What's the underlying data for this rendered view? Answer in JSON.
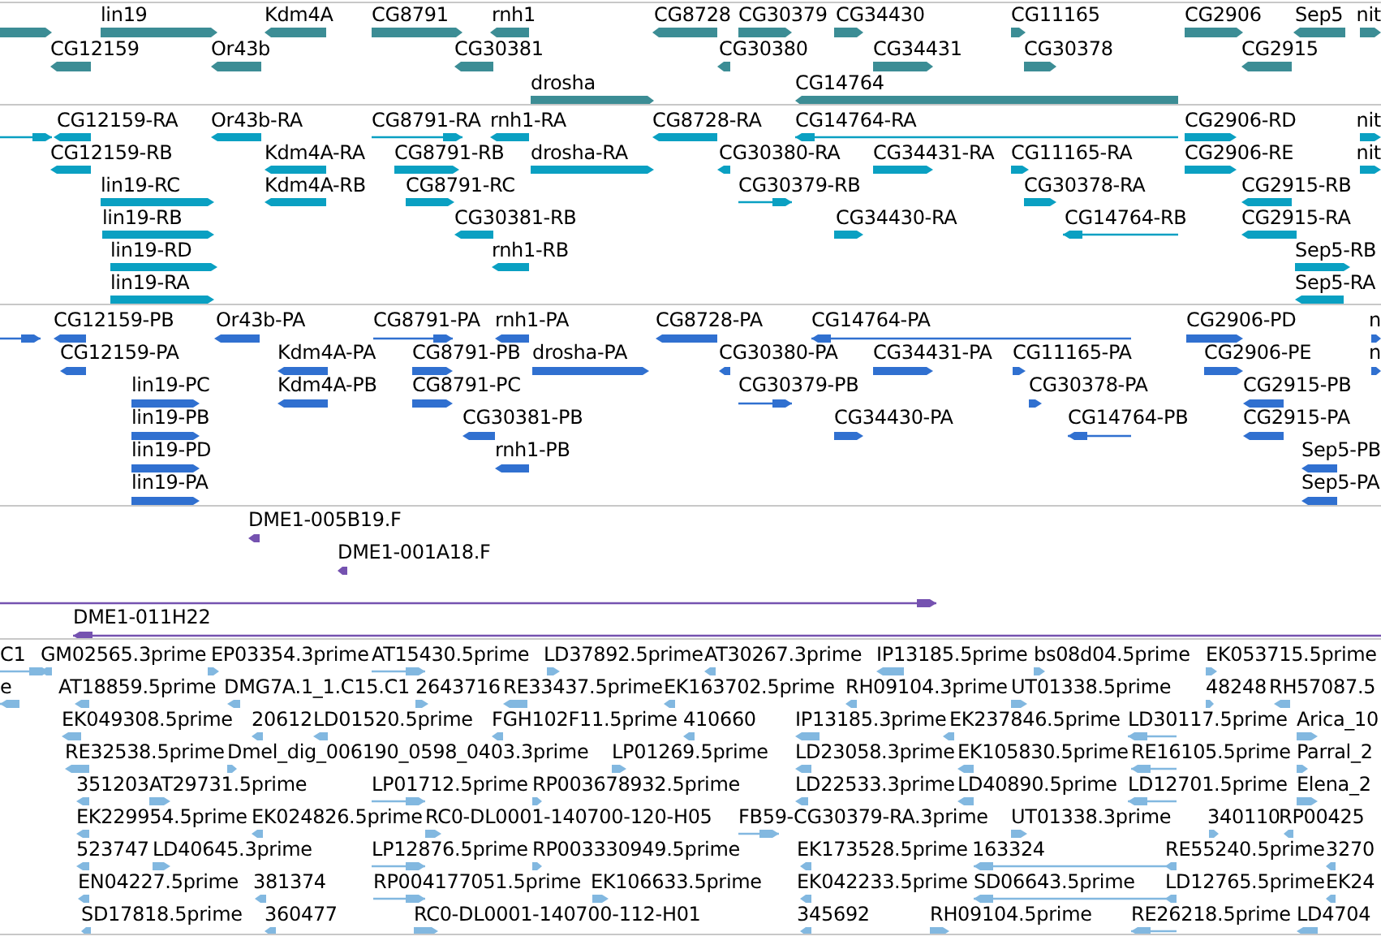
{
  "tracks": [
    {
      "kind": "genes",
      "features": [
        {
          "reverse": false
        },
        {
          "label": "lin19",
          "reverse": false
        },
        {
          "label": "Kdm4A",
          "reverse": true
        },
        {
          "label": "CG8791",
          "reverse": false
        },
        {
          "label": "rnh1",
          "reverse": true
        },
        {
          "label": "CG8728",
          "reverse": true
        },
        {
          "label": "CG30379",
          "reverse": false
        },
        {
          "label": "CG34430",
          "reverse": false
        },
        {
          "label": "CG11165",
          "reverse": false
        },
        {
          "label": "CG2906",
          "reverse": false
        },
        {
          "label": "Sep5",
          "reverse": true
        },
        {
          "label": "nit",
          "reverse": false
        },
        {
          "label": "CG12159",
          "reverse": true
        },
        {
          "label": "Or43b",
          "reverse": true
        },
        {
          "label": "CG30381",
          "reverse": true
        },
        {
          "label": "CG30380",
          "reverse": true
        },
        {
          "label": "CG34431",
          "reverse": false
        },
        {
          "label": "CG30378",
          "reverse": false
        },
        {
          "label": "CG2915",
          "reverse": true
        },
        {
          "label": "drosha",
          "reverse": false
        },
        {
          "label": "CG14764",
          "reverse": true
        }
      ]
    },
    {
      "kind": "transcripts",
      "features": [
        {
          "reverse": false
        },
        {
          "label": "CG12159-RA",
          "reverse": true
        },
        {
          "label": "Or43b-RA",
          "reverse": true
        },
        {
          "label": "CG8791-RA",
          "reverse": false
        },
        {
          "label": "rnh1-RA",
          "reverse": true
        },
        {
          "label": "CG8728-RA",
          "reverse": true
        },
        {
          "label": "CG14764-RA",
          "reverse": true
        },
        {
          "label": "CG2906-RD",
          "reverse": false
        },
        {
          "label": "nit",
          "reverse": false
        },
        {
          "label": "CG12159-RB",
          "reverse": true
        },
        {
          "label": "Kdm4A-RA",
          "reverse": true
        },
        {
          "label": "CG8791-RB",
          "reverse": false
        },
        {
          "label": "drosha-RA",
          "reverse": false
        },
        {
          "label": "CG30380-RA",
          "reverse": true
        },
        {
          "label": "CG34431-RA",
          "reverse": false
        },
        {
          "label": "CG11165-RA",
          "reverse": false
        },
        {
          "label": "CG2906-RE",
          "reverse": false
        },
        {
          "label": "nit",
          "reverse": false
        },
        {
          "label": "lin19-RC",
          "reverse": false
        },
        {
          "label": "Kdm4A-RB",
          "reverse": true
        },
        {
          "label": "CG8791-RC",
          "reverse": false
        },
        {
          "label": "CG30379-RB",
          "reverse": false
        },
        {
          "label": "CG30378-RA",
          "reverse": false
        },
        {
          "label": "CG2915-RB",
          "reverse": true
        },
        {
          "label": "lin19-RB",
          "reverse": false
        },
        {
          "label": "CG30381-RB",
          "reverse": true
        },
        {
          "label": "CG34430-RA",
          "reverse": false
        },
        {
          "label": "CG14764-RB",
          "reverse": true
        },
        {
          "label": "CG2915-RA",
          "reverse": true
        },
        {
          "label": "lin19-RD",
          "reverse": false
        },
        {
          "label": "rnh1-RB",
          "reverse": true
        },
        {
          "label": "Sep5-RB",
          "reverse": false
        },
        {
          "label": "lin19-RA",
          "reverse": false
        },
        {
          "label": "Sep5-RA",
          "reverse": true
        }
      ]
    },
    {
      "kind": "proteins",
      "features": [
        {
          "reverse": false
        },
        {
          "label": "CG12159-PB",
          "reverse": true
        },
        {
          "label": "Or43b-PA",
          "reverse": true
        },
        {
          "label": "CG8791-PA",
          "reverse": false
        },
        {
          "label": "rnh1-PA",
          "reverse": true
        },
        {
          "label": "CG8728-PA",
          "reverse": true
        },
        {
          "label": "CG14764-PA",
          "reverse": true
        },
        {
          "label": "CG2906-PD",
          "reverse": false
        },
        {
          "label": "n",
          "reverse": false
        },
        {
          "label": "CG12159-PA",
          "reverse": true
        },
        {
          "label": "Kdm4A-PA",
          "reverse": true
        },
        {
          "label": "CG8791-PB",
          "reverse": false
        },
        {
          "label": "drosha-PA",
          "reverse": false
        },
        {
          "label": "CG30380-PA",
          "reverse": true
        },
        {
          "label": "CG34431-PA",
          "reverse": false
        },
        {
          "label": "CG11165-PA",
          "reverse": false
        },
        {
          "label": "CG2906-PE",
          "reverse": false
        },
        {
          "label": "n",
          "reverse": false
        },
        {
          "label": "lin19-PC",
          "reverse": false
        },
        {
          "label": "Kdm4A-PB",
          "reverse": true
        },
        {
          "label": "CG8791-PC",
          "reverse": false
        },
        {
          "label": "CG30379-PB",
          "reverse": false
        },
        {
          "label": "CG30378-PA",
          "reverse": false
        },
        {
          "label": "CG2915-PB",
          "reverse": true
        },
        {
          "label": "lin19-PB",
          "reverse": false
        },
        {
          "label": "CG30381-PB",
          "reverse": true
        },
        {
          "label": "CG34430-PA",
          "reverse": false
        },
        {
          "label": "CG14764-PB",
          "reverse": true
        },
        {
          "label": "CG2915-PA",
          "reverse": true
        },
        {
          "label": "lin19-PD",
          "reverse": false
        },
        {
          "label": "rnh1-PB",
          "reverse": true
        },
        {
          "label": "Sep5-PB",
          "reverse": true
        },
        {
          "label": "lin19-PA",
          "reverse": false
        },
        {
          "label": "Sep5-PA",
          "reverse": true
        }
      ]
    },
    {
      "kind": "clones",
      "features": [
        {
          "label": "DME1-005B19.F",
          "reverse": true
        },
        {
          "label": "DME1-001A18.F",
          "reverse": true
        },
        {
          "reverse": false
        },
        {
          "label": "DME1-011H22",
          "reverse": true
        }
      ]
    },
    {
      "kind": "ests",
      "features": [
        {
          "label": "C1",
          "reverse": false
        },
        {
          "label": "GM02565.3prime",
          "reverse": true
        },
        {
          "label": "EP03354.3prime",
          "reverse": false
        },
        {
          "label": "AT15430.5prime",
          "reverse": false
        },
        {
          "label": "LD37892.5prime",
          "reverse": false
        },
        {
          "label": "AT30267.3prime",
          "reverse": true
        },
        {
          "label": "IP13185.5prime",
          "reverse": true
        },
        {
          "label": "bs08d04.5prime",
          "reverse": false
        },
        {
          "label": "EK053715.5prime",
          "reverse": false
        },
        {
          "label": "e",
          "reverse": true
        },
        {
          "label": "AT18859.5prime",
          "reverse": true
        },
        {
          "label": "DMG7A.1_1.C15.C1",
          "reverse": true
        },
        {
          "label": "2643716",
          "reverse": false
        },
        {
          "label": "RE33437.5prime",
          "reverse": true
        },
        {
          "label": "EK163702.5prime",
          "reverse": true
        },
        {
          "label": "RH09104.3prime",
          "reverse": true
        },
        {
          "label": "UT01338.5prime",
          "reverse": false
        },
        {
          "label": "48248",
          "reverse": false
        },
        {
          "label": "RH57087.5",
          "reverse": true
        },
        {
          "label": "EK049308.5prime",
          "reverse": true
        },
        {
          "label": "20612",
          "reverse": true
        },
        {
          "label": "LD01520.5prime",
          "reverse": true
        },
        {
          "label": "FGH102F11.5prime",
          "reverse": true
        },
        {
          "label": "410660",
          "reverse": true
        },
        {
          "label": "IP13185.3prime",
          "reverse": true
        },
        {
          "label": "EK237846.5prime",
          "reverse": true
        },
        {
          "label": "LD30117.5prime",
          "reverse": true
        },
        {
          "label": "Arica_10",
          "reverse": false
        },
        {
          "label": "RE32538.5prime",
          "reverse": true
        },
        {
          "label": "Dmel_dig_006190_0598_0403.3prime",
          "reverse": false
        },
        {
          "label": "LP01269.5prime",
          "reverse": false
        },
        {
          "label": "LD23058.3prime",
          "reverse": true
        },
        {
          "label": "EK105830.5prime",
          "reverse": true
        },
        {
          "label": "RE16105.5prime",
          "reverse": true
        },
        {
          "label": "Parral_2",
          "reverse": false
        },
        {
          "label": "351203",
          "reverse": true
        },
        {
          "label": "AT29731.5prime",
          "reverse": false
        },
        {
          "label": "LP01712.5prime",
          "reverse": false
        },
        {
          "label": "RP003678932.5prime",
          "reverse": false
        },
        {
          "label": "LD22533.3prime",
          "reverse": true
        },
        {
          "label": "LD40890.5prime",
          "reverse": true
        },
        {
          "label": "LD12701.5prime",
          "reverse": true
        },
        {
          "label": "Elena_2",
          "reverse": false
        },
        {
          "label": "EK229954.5prime",
          "reverse": true
        },
        {
          "label": "EK024826.5prime",
          "reverse": true
        },
        {
          "label": "RC0-DL0001-140700-120-H05",
          "reverse": false
        },
        {
          "label": "FB59-CG30379-RA.3prime",
          "reverse": false
        },
        {
          "label": "UT01338.3prime",
          "reverse": false
        },
        {
          "label": "340110",
          "reverse": false
        },
        {
          "label": "RP00425",
          "reverse": true
        },
        {
          "label": "523747",
          "reverse": true
        },
        {
          "label": "LD40645.3prime",
          "reverse": false
        },
        {
          "label": "LP12876.5prime",
          "reverse": false
        },
        {
          "label": "RP003330949.5prime",
          "reverse": false
        },
        {
          "label": "EK173528.5prime",
          "reverse": true
        },
        {
          "label": "163324",
          "reverse": true
        },
        {
          "label": "RE55240.5prime",
          "reverse": true
        },
        {
          "label": "3270",
          "reverse": true
        },
        {
          "label": "EN04227.5prime",
          "reverse": true
        },
        {
          "label": "381374",
          "reverse": true
        },
        {
          "label": "RP004177051.5prime",
          "reverse": false
        },
        {
          "label": "EK106633.5prime",
          "reverse": false
        },
        {
          "label": "EK042233.5prime",
          "reverse": true
        },
        {
          "label": "SD06643.5prime",
          "reverse": true
        },
        {
          "label": "LD12765.5prime",
          "reverse": true
        },
        {
          "label": "EK24",
          "reverse": true
        },
        {
          "label": "SD17818.5prime",
          "reverse": true
        },
        {
          "label": "360477",
          "reverse": true
        },
        {
          "label": "RC0-DL0001-140700-112-H01",
          "reverse": false
        },
        {
          "label": "345692",
          "reverse": true
        },
        {
          "label": "RH09104.5prime",
          "reverse": false
        },
        {
          "label": "RE26218.5prime",
          "reverse": true
        },
        {
          "label": "LD4704",
          "reverse": true
        }
      ]
    }
  ]
}
